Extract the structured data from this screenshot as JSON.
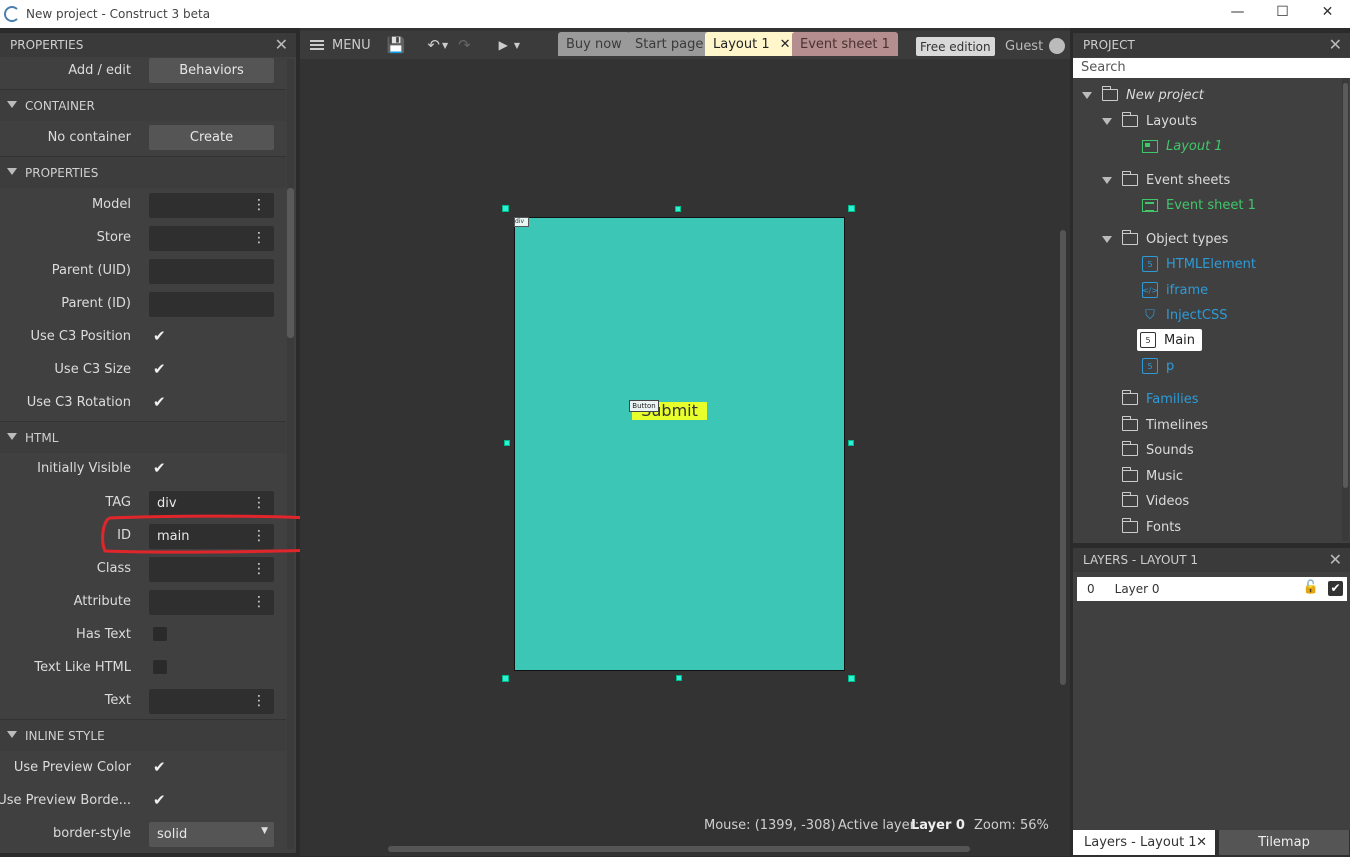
{
  "window": {
    "title": "New project - Construct 3 beta",
    "controls": {
      "minimize": "—",
      "maximize": "☐",
      "close": "✕"
    }
  },
  "properties_panel": {
    "title": "PROPERTIES",
    "add_edit": {
      "label": "Add / edit",
      "button": "Behaviors"
    },
    "container_section": {
      "title": "CONTAINER",
      "label": "No container",
      "button": "Create"
    },
    "properties_section": {
      "title": "PROPERTIES"
    },
    "rows": {
      "model": {
        "label": "Model",
        "value": ""
      },
      "store": {
        "label": "Store",
        "value": ""
      },
      "parent_uid": {
        "label": "Parent (UID)",
        "value": ""
      },
      "parent_id": {
        "label": "Parent (ID)",
        "value": ""
      },
      "use_c3_position": {
        "label": "Use C3 Position",
        "checked": true
      },
      "use_c3_size": {
        "label": "Use C3 Size",
        "checked": true
      },
      "use_c3_rotation": {
        "label": "Use C3 Rotation",
        "checked": true
      }
    },
    "html_section": {
      "title": "HTML",
      "initially_visible": {
        "label": "Initially Visible",
        "checked": true
      },
      "tag": {
        "label": "TAG",
        "value": "div"
      },
      "id": {
        "label": "ID",
        "value": "main"
      },
      "class": {
        "label": "Class",
        "value": ""
      },
      "attribute": {
        "label": "Attribute",
        "value": ""
      },
      "has_text": {
        "label": "Has Text",
        "checked": false
      },
      "text_like_html": {
        "label": "Text Like HTML",
        "checked": false
      },
      "text": {
        "label": "Text",
        "value": ""
      }
    },
    "inline_style_section": {
      "title": "INLINE STYLE",
      "use_preview_color": {
        "label": "Use Preview Color",
        "checked": true
      },
      "use_preview_border": {
        "label": "Use Preview Borde...",
        "checked": true
      },
      "border_style": {
        "label": "border-style",
        "value": "solid"
      }
    }
  },
  "toolbar": {
    "menu_label": "MENU",
    "tabs": {
      "buy_now": "Buy now",
      "start_page": "Start page",
      "layout1": "Layout 1",
      "event_sheet1": "Event sheet 1"
    },
    "free_edition": "Free edition",
    "guest": "Guest"
  },
  "canvas": {
    "div_tag": "div",
    "button_tag": "Button",
    "submit_text": "Submit",
    "colors": {
      "layout_fill": "#3cc6b5",
      "button_fill": "#e7ff2a",
      "handles": "#2ef0d8"
    }
  },
  "status_bar": {
    "mouse": "Mouse: (1399, -308)",
    "active_layer_label": "Active layer:",
    "active_layer_value": "Layer 0",
    "zoom": "Zoom: 56%"
  },
  "project_panel": {
    "title": "PROJECT",
    "search_placeholder": "Search",
    "root": "New project",
    "layouts": "Layouts",
    "layout1": "Layout 1",
    "event_sheets": "Event sheets",
    "event_sheet1": "Event sheet 1",
    "object_types": "Object types",
    "objects": [
      "HTMLElement",
      "iframe",
      "InjectCSS",
      "Main",
      "p"
    ],
    "families": "Families",
    "timelines": "Timelines",
    "sounds": "Sounds",
    "music": "Music",
    "videos": "Videos",
    "fonts": "Fonts"
  },
  "layers_panel": {
    "title": "LAYERS - LAYOUT 1",
    "layer_index": "0",
    "layer_name": "Layer 0"
  },
  "bottom_tabs": {
    "layers": "Layers - Layout 1",
    "tilemap": "Tilemap"
  }
}
